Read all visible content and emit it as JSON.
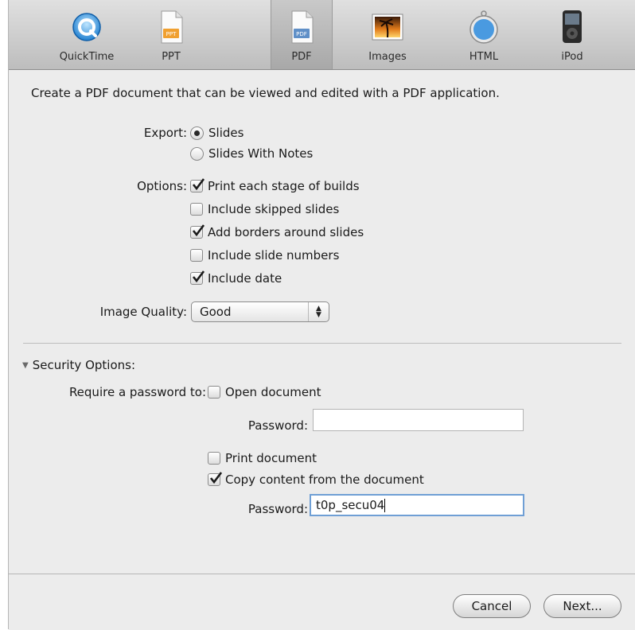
{
  "toolbar": {
    "items": [
      {
        "label": "QuickTime",
        "icon": "quicktime-icon"
      },
      {
        "label": "PPT",
        "icon": "ppt-document-icon"
      },
      {
        "label": "PDF",
        "icon": "pdf-document-icon"
      },
      {
        "label": "Images",
        "icon": "images-icon"
      },
      {
        "label": "HTML",
        "icon": "safari-compass-icon"
      },
      {
        "label": "iPod",
        "icon": "ipod-icon"
      }
    ],
    "selected": "PDF"
  },
  "description": "Create a PDF document that can be viewed and edited with a PDF application.",
  "export": {
    "label": "Export:",
    "options": [
      "Slides",
      "Slides With Notes"
    ],
    "selected": "Slides"
  },
  "options": {
    "label": "Options:",
    "items": [
      {
        "label": "Print each stage of builds",
        "checked": true
      },
      {
        "label": "Include skipped slides",
        "checked": false
      },
      {
        "label": "Add borders around slides",
        "checked": true
      },
      {
        "label": "Include slide numbers",
        "checked": false
      },
      {
        "label": "Include date",
        "checked": true
      }
    ]
  },
  "image_quality": {
    "label": "Image Quality:",
    "value": "Good"
  },
  "security": {
    "title": "Security Options:",
    "require_label": "Require a password to:",
    "open_document": {
      "label": "Open document",
      "checked": false
    },
    "password_label": "Password:",
    "open_password": "",
    "print_document": {
      "label": "Print document",
      "checked": false
    },
    "copy_content": {
      "label": "Copy content from the document",
      "checked": true
    },
    "copy_password": "t0p_secu04"
  },
  "buttons": {
    "cancel": "Cancel",
    "next": "Next..."
  },
  "colors": {
    "focus_ring": "#6f9fd5",
    "window_bg": "#ececec"
  }
}
